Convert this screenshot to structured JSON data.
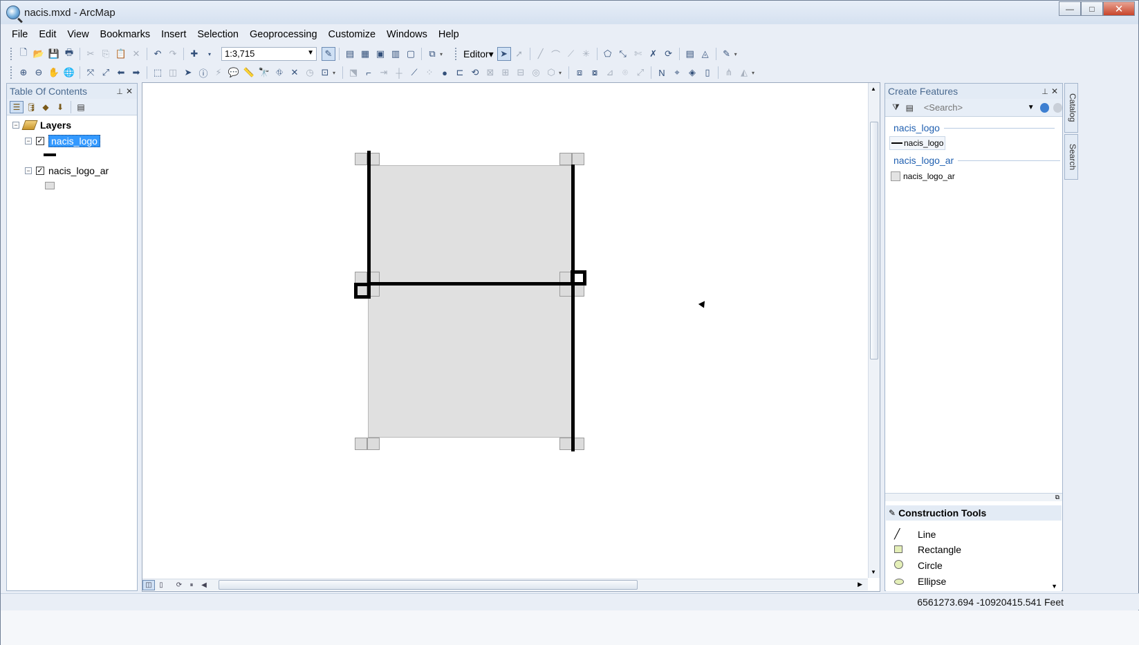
{
  "window": {
    "title": "nacis.mxd - ArcMap",
    "min_label": "—",
    "max_label": "□",
    "close_label": "✕"
  },
  "menu": [
    "File",
    "Edit",
    "View",
    "Bookmarks",
    "Insert",
    "Selection",
    "Geoprocessing",
    "Customize",
    "Windows",
    "Help"
  ],
  "toolbar": {
    "scale": "1:3,715",
    "editor_label": "Editor▾"
  },
  "toc": {
    "title": "Table Of Contents",
    "root_label": "Layers",
    "layers": [
      {
        "name": "nacis_logo",
        "checked": "✓",
        "symbol": "line"
      },
      {
        "name": "nacis_logo_ar",
        "checked": "✓",
        "symbol": "polygon"
      }
    ]
  },
  "create_features": {
    "title": "Create Features",
    "search_placeholder": "<Search>",
    "groups": [
      {
        "header": "nacis_logo",
        "item": "nacis_logo"
      },
      {
        "header": "nacis_logo_ar",
        "item": "nacis_logo_ar"
      }
    ]
  },
  "construction_tools": {
    "title": "Construction Tools",
    "items": [
      "Line",
      "Rectangle",
      "Circle",
      "Ellipse"
    ]
  },
  "side_tabs": [
    "Catalog",
    "Search"
  ],
  "status": {
    "coordinates": "6561273.694  -10920415.541 Feet"
  }
}
